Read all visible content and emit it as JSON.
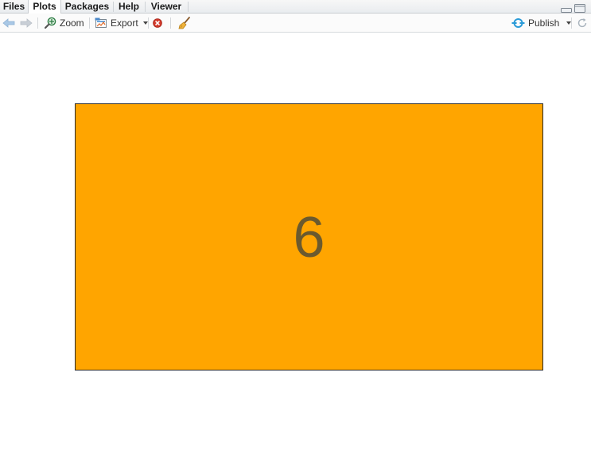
{
  "tabs": [
    {
      "label": "Files",
      "active": false
    },
    {
      "label": "Plots",
      "active": true
    },
    {
      "label": "Packages",
      "active": false
    },
    {
      "label": "Help",
      "active": false
    },
    {
      "label": "Viewer",
      "active": false
    }
  ],
  "toolbar": {
    "back_icon": "arrow-left-icon",
    "forward_icon": "arrow-right-icon",
    "zoom_label": "Zoom",
    "export_label": "Export",
    "remove_icon": "remove-plot-icon",
    "clear_icon": "broom-icon",
    "publish_label": "Publish",
    "refresh_icon": "refresh-icon"
  },
  "plot": {
    "value": "6",
    "fill_color": "#FFA500",
    "text_color": "#6B5A2E",
    "border_color": "#2B2B2B"
  }
}
